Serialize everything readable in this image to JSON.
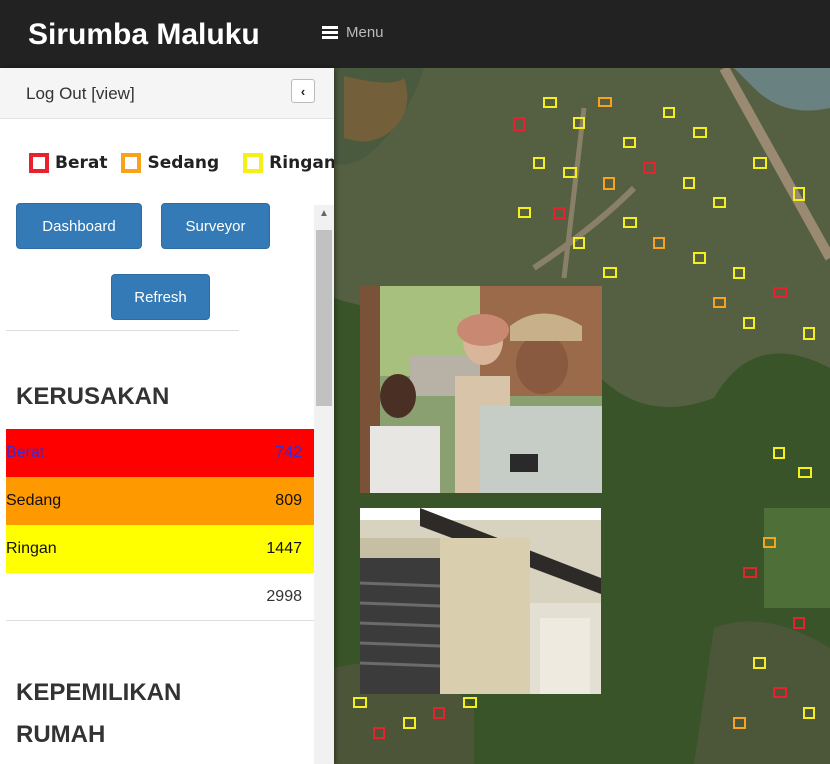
{
  "app": {
    "title": "Sirumba Maluku",
    "menu_label": "Menu"
  },
  "sidebar": {
    "logout_label": "Log Out [view]",
    "collapse_icon": "‹",
    "legend": [
      {
        "label": "Berat",
        "color": "#e8212e"
      },
      {
        "label": "Sedang",
        "color": "#f7a31c"
      },
      {
        "label": "Ringan",
        "color": "#f5f01c"
      }
    ],
    "buttons": {
      "dashboard": "Dashboard",
      "surveyor": "Surveyor",
      "refresh": "Refresh"
    }
  },
  "kerusakan": {
    "heading": "KERUSAKAN",
    "rows": [
      {
        "label": "Berat",
        "value": "742",
        "bg": "#ff0000",
        "color": "#3b2bd1"
      },
      {
        "label": "Sedang",
        "value": "809",
        "bg": "#ff9900",
        "color": "#111111"
      },
      {
        "label": "Ringan",
        "value": "1447",
        "bg": "#ffff00",
        "color": "#111111"
      }
    ],
    "total": "2998"
  },
  "kepemilikan": {
    "heading": "KEPEMILIKAN RUMAH"
  }
}
